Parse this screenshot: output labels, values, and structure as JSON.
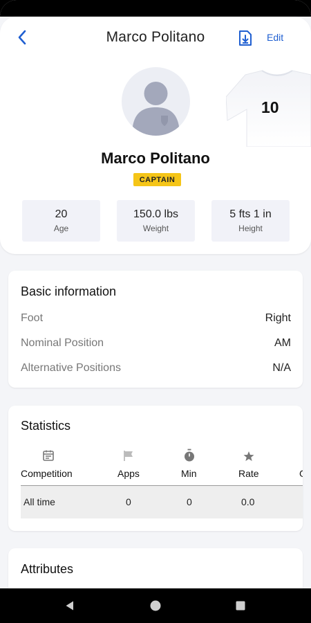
{
  "header": {
    "title": "Marco Politano",
    "edit_label": "Edit"
  },
  "profile": {
    "name": "Marco Politano",
    "badge": "CAPTAIN",
    "jersey_number": "10",
    "stats": [
      {
        "value": "20",
        "label": "Age"
      },
      {
        "value": "150.0 lbs",
        "label": "Weight"
      },
      {
        "value": "5 fts 1 in",
        "label": "Height"
      }
    ]
  },
  "basic_info": {
    "title": "Basic information",
    "rows": [
      {
        "key": "Foot",
        "value": "Right"
      },
      {
        "key": "Nominal Position",
        "value": "AM"
      },
      {
        "key": "Alternative Positions",
        "value": "N/A"
      }
    ]
  },
  "statistics": {
    "title": "Statistics",
    "columns": [
      {
        "label": "Competition",
        "icon": "calendar-icon"
      },
      {
        "label": "Apps",
        "icon": "flag-icon"
      },
      {
        "label": "Min",
        "icon": "stopwatch-icon"
      },
      {
        "label": "Rate",
        "icon": "star-icon"
      },
      {
        "label": "G",
        "icon": ""
      }
    ],
    "rows": [
      {
        "competition": "All time",
        "apps": "0",
        "min": "0",
        "rate": "0.0"
      }
    ]
  },
  "attributes": {
    "title": "Attributes"
  },
  "colors": {
    "accent": "#1f5fd1",
    "badge": "#f5c518",
    "background": "#f4f5f8"
  }
}
